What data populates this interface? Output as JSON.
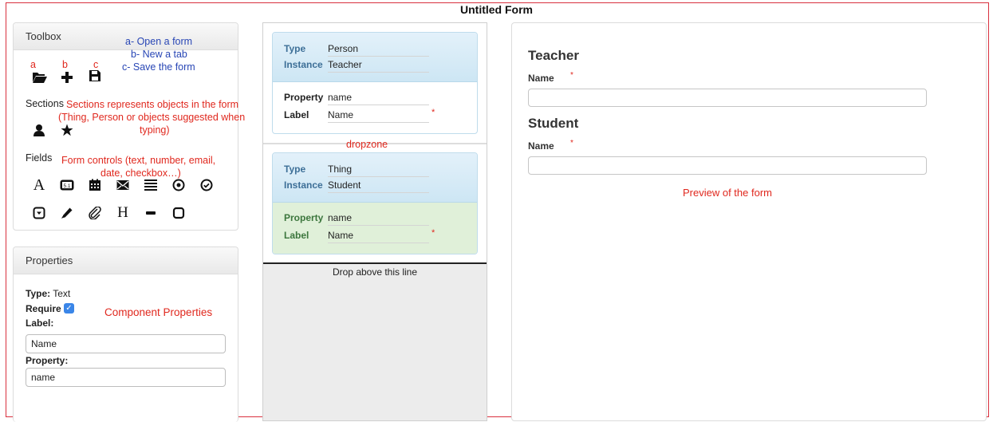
{
  "form": {
    "title": "Untitled Form"
  },
  "toolbox": {
    "title": "Toolbox",
    "top_icons": [
      {
        "key": "a",
        "icon": "folder-open-icon"
      },
      {
        "key": "b",
        "icon": "plus-icon"
      },
      {
        "key": "c",
        "icon": "save-icon"
      }
    ],
    "sections_label": "Sections",
    "section_icons": [
      "user-icon",
      "star-icon"
    ],
    "fields_label": "Fields",
    "field_icons": [
      "text-icon",
      "number-icon",
      "date-icon",
      "email-icon",
      "list-icon",
      "radio-icon",
      "checkbox-icon",
      "dropdown-icon",
      "pencil-icon",
      "attachment-icon",
      "heading-icon",
      "separator-icon",
      "square-icon"
    ]
  },
  "annotations": {
    "open_form": "a- Open a form",
    "new_tab": "b- New a tab",
    "save_form": "c- Save the form",
    "sections_line1": "Sections represents objects in the form",
    "sections_line2": "(Thing, Person or objects suggested when",
    "sections_line3": "typing)",
    "fields_line1": "Form controls (text, number, email,",
    "fields_line2": "date, checkbox…)",
    "component_properties": "Component Properties",
    "dropzone": "dropzone",
    "preview": "Preview of the form"
  },
  "properties": {
    "title": "Properties",
    "type_label": "Type:",
    "type_value": "Text",
    "require_label": "Require",
    "require_checked": true,
    "label_label": "Label:",
    "label_value": "Name",
    "property_label": "Property:",
    "property_value": "name"
  },
  "dropzone": {
    "sections": [
      {
        "type_label": "Type",
        "type_value": "Person",
        "instance_label": "Instance",
        "instance_value": "Teacher",
        "property_label": "Property",
        "property_value": "name",
        "label_label": "Label",
        "label_value": "Name",
        "required": "*"
      },
      {
        "type_label": "Type",
        "type_value": "Thing",
        "instance_label": "Instance",
        "instance_value": "Student",
        "property_label": "Property",
        "property_value": "name",
        "label_label": "Label",
        "label_value": "Name",
        "required": "*"
      }
    ],
    "drop_hint": "Drop above this line"
  },
  "preview": {
    "sections": [
      {
        "title": "Teacher",
        "field_label": "Name",
        "required": "*"
      },
      {
        "title": "Student",
        "field_label": "Name",
        "required": "*"
      }
    ]
  },
  "colors": {
    "annotation_red": "#e0281e",
    "annotation_blue": "#2846b5",
    "frame_red": "#d9303e",
    "checkbox_blue": "#3a86e8"
  }
}
